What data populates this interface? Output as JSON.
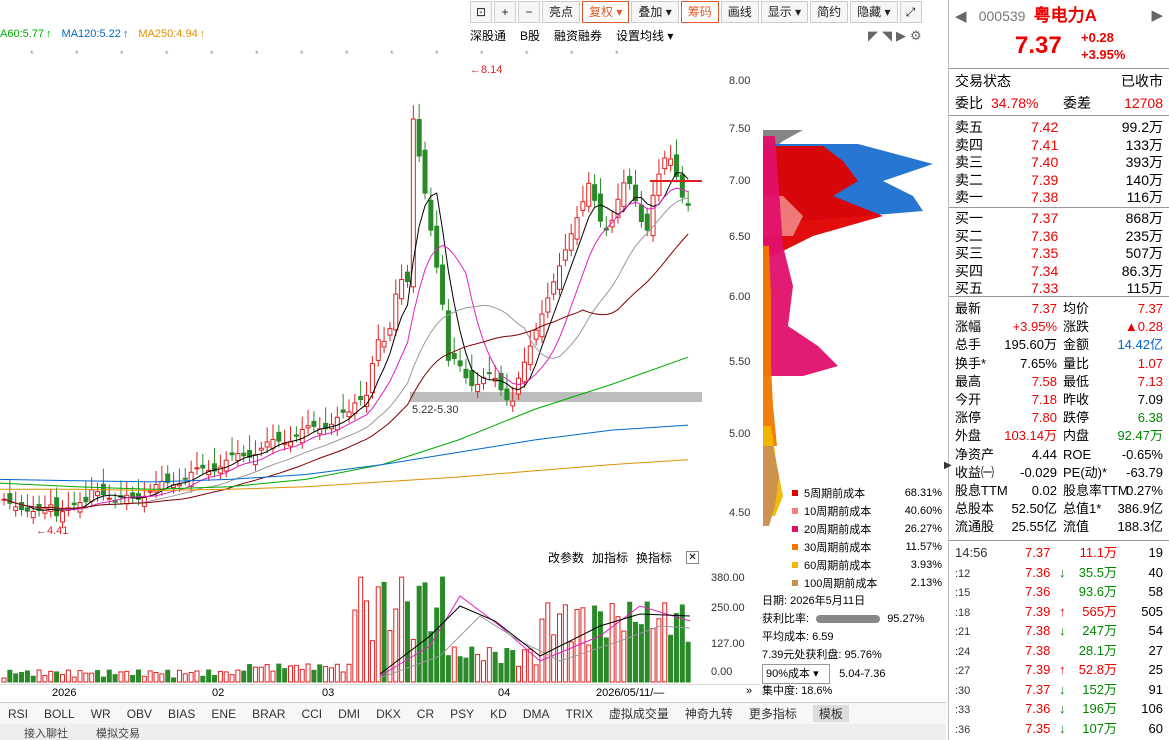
{
  "toolbar": {
    "buttons": [
      "亮点",
      "复权",
      "叠加",
      "筹码",
      "画线",
      "显示",
      "简约",
      "隐藏"
    ],
    "active": [
      "复权",
      "筹码"
    ]
  },
  "ma_legend": [
    {
      "text": "A60:5.77",
      "color": "#0a0"
    },
    {
      "text": "MA120:5.22",
      "color": "#06c"
    },
    {
      "text": "MA250:4.94",
      "color": "#e09000"
    }
  ],
  "stock_ops": [
    "深股通",
    "B股",
    "融资融券",
    "设置均线"
  ],
  "price_labels": {
    "high": "8.14",
    "low": "4.41",
    "gap": "5.22-5.30"
  },
  "right_axis": [
    "8.00",
    "7.50",
    "7.00",
    "6.50",
    "6.00",
    "5.50",
    "5.00",
    "4.50"
  ],
  "chip_legend": [
    {
      "label": "5周期前成本",
      "pct": "68.31%",
      "color": "#e00000"
    },
    {
      "label": "10周期前成本",
      "pct": "40.60%",
      "color": "#f08080"
    },
    {
      "label": "20周期前成本",
      "pct": "26.27%",
      "color": "#e0106a"
    },
    {
      "label": "30周期前成本",
      "pct": "11.57%",
      "color": "#f07800"
    },
    {
      "label": "60周期前成本",
      "pct": "3.93%",
      "color": "#f0b800"
    },
    {
      "label": "100周期前成本",
      "pct": "2.13%",
      "color": "#c89050"
    }
  ],
  "chip_info": {
    "date": "日期: 2026年5月11日",
    "profit_label": "获利比率:",
    "profit": "95.27%",
    "avg_cost": "平均成本: 6.59",
    "profit_at": "7.39元处获利盘: 95.76%",
    "cost_select": "90%成本",
    "cost_range": "5.04-7.36",
    "concentration": "集中度: 18.6%"
  },
  "vol_header": [
    "改参数",
    "加指标",
    "换指标"
  ],
  "vol_axis": [
    "380.00",
    "250.00",
    "127.00",
    "0.00"
  ],
  "date_axis": [
    "2026",
    "02",
    "03",
    "04",
    "2026/05/11/—"
  ],
  "indicators": [
    "RSI",
    "BOLL",
    "WR",
    "OBV",
    "BIAS",
    "ENE",
    "BRAR",
    "CCI",
    "DMI",
    "DKX",
    "CR",
    "PSY",
    "KD",
    "DMA",
    "TRIX",
    "虚拟成交量",
    "神奇九转",
    "更多指标",
    "模板"
  ],
  "bottom": [
    "接入聊社",
    "模拟交易"
  ],
  "quote": {
    "code": "000539",
    "name": "粤电力A",
    "price": "7.37",
    "change": "+0.28",
    "pct": "+3.95%",
    "status_label": "交易状态",
    "status": "已收市",
    "wb_label": "委比",
    "wb": "34.78%",
    "wc_label": "委差",
    "wc": "12708"
  },
  "asks": [
    {
      "label": "卖五",
      "price": "7.42",
      "vol": "99.2万"
    },
    {
      "label": "卖四",
      "price": "7.41",
      "vol": "133万"
    },
    {
      "label": "卖三",
      "price": "7.40",
      "vol": "393万"
    },
    {
      "label": "卖二",
      "price": "7.39",
      "vol": "140万"
    },
    {
      "label": "卖一",
      "price": "7.38",
      "vol": "116万"
    }
  ],
  "bids": [
    {
      "label": "买一",
      "price": "7.37",
      "vol": "868万"
    },
    {
      "label": "买二",
      "price": "7.36",
      "vol": "235万"
    },
    {
      "label": "买三",
      "price": "7.35",
      "vol": "507万"
    },
    {
      "label": "买四",
      "price": "7.34",
      "vol": "86.3万"
    },
    {
      "label": "买五",
      "price": "7.33",
      "vol": "115万"
    }
  ],
  "stats": [
    {
      "l1": "最新",
      "v1": "7.37",
      "c1": "red",
      "l2": "均价",
      "v2": "7.37",
      "c2": "red"
    },
    {
      "l1": "涨幅",
      "v1": "+3.95%",
      "c1": "red",
      "l2": "涨跌",
      "v2": "▲0.28",
      "c2": "red"
    },
    {
      "l1": "总手",
      "v1": "195.60万",
      "c1": "blk",
      "l2": "金额",
      "v2": "14.42亿",
      "c2": "blue"
    },
    {
      "l1": "换手*",
      "v1": "7.65%",
      "c1": "blk",
      "l2": "量比",
      "v2": "1.07",
      "c2": "red"
    },
    {
      "l1": "最高",
      "v1": "7.58",
      "c1": "red",
      "l2": "最低",
      "v2": "7.13",
      "c2": "red"
    },
    {
      "l1": "今开",
      "v1": "7.18",
      "c1": "red",
      "l2": "昨收",
      "v2": "7.09",
      "c2": "blk"
    },
    {
      "l1": "涨停",
      "v1": "7.80",
      "c1": "red",
      "l2": "跌停",
      "v2": "6.38",
      "c2": "green"
    },
    {
      "l1": "外盘",
      "v1": "103.14万",
      "c1": "red",
      "l2": "内盘",
      "v2": "92.47万",
      "c2": "green"
    },
    {
      "l1": "净资产",
      "v1": "4.44",
      "c1": "blk",
      "l2": "ROE",
      "v2": "-0.65%",
      "c2": "blk"
    },
    {
      "l1": "收益㈠",
      "v1": "-0.029",
      "c1": "blk",
      "l2": "PE(动)*",
      "v2": "-63.79",
      "c2": "blk"
    },
    {
      "l1": "股息TTM",
      "v1": "0.02",
      "c1": "blk",
      "l2": "股息率TTM",
      "v2": "0.27%",
      "c2": "blk"
    },
    {
      "l1": "总股本",
      "v1": "52.50亿",
      "c1": "blk",
      "l2": "总值1*",
      "v2": "386.9亿",
      "c2": "blk"
    },
    {
      "l1": "流通股",
      "v1": "25.55亿",
      "c1": "blk",
      "l2": "流值",
      "v2": "188.3亿",
      "c2": "blk"
    }
  ],
  "ticks": [
    {
      "time": "14:56",
      "price": "7.37",
      "vol": "11.1万",
      "n": "19",
      "dir": "",
      "vc": "red"
    },
    {
      "time": ":12",
      "price": "7.36",
      "vol": "35.5万",
      "n": "40",
      "dir": "↓",
      "vc": "green"
    },
    {
      "time": ":15",
      "price": "7.36",
      "vol": "93.6万",
      "n": "58",
      "dir": "",
      "vc": "green"
    },
    {
      "time": ":18",
      "price": "7.39",
      "vol": "565万",
      "n": "505",
      "dir": "↑",
      "vc": "red"
    },
    {
      "time": ":21",
      "price": "7.38",
      "vol": "247万",
      "n": "54",
      "dir": "↓",
      "vc": "green"
    },
    {
      "time": ":24",
      "price": "7.38",
      "vol": "28.1万",
      "n": "27",
      "dir": "",
      "vc": "green"
    },
    {
      "time": ":27",
      "price": "7.39",
      "vol": "52.8万",
      "n": "25",
      "dir": "↑",
      "vc": "red"
    },
    {
      "time": ":30",
      "price": "7.37",
      "vol": "152万",
      "n": "91",
      "dir": "↓",
      "vc": "green"
    },
    {
      "time": ":33",
      "price": "7.36",
      "vol": "196万",
      "n": "106",
      "dir": "↓",
      "vc": "green"
    },
    {
      "time": ":36",
      "price": "7.35",
      "vol": "107万",
      "n": "60",
      "dir": "↓",
      "vc": "green"
    }
  ]
}
